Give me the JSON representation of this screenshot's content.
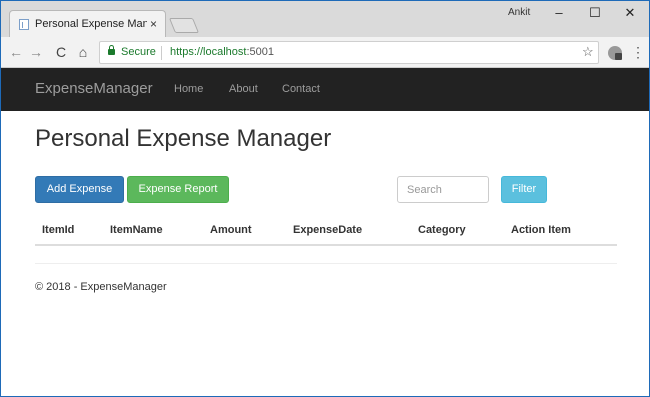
{
  "browser": {
    "tab_title": "Personal Expense Manag",
    "tab_close": "×",
    "user": "Ankit",
    "window_controls": {
      "minimize": "–",
      "maximize": "☐",
      "close": "✕"
    },
    "back": "←",
    "forward": "→",
    "reload": "C",
    "home": "⌂",
    "secure_label": "Secure",
    "url_scheme_host": "https://localhost",
    "url_port": ":5001",
    "star": "☆",
    "menu": "⋮"
  },
  "navbar": {
    "brand": "ExpenseManager",
    "links": [
      "Home",
      "About",
      "Contact"
    ]
  },
  "main": {
    "title": "Personal Expense Manager",
    "add_button": "Add Expense",
    "report_button": "Expense Report",
    "search_placeholder": "Search",
    "filter_button": "Filter",
    "table_headers": [
      "ItemId",
      "ItemName",
      "Amount",
      "ExpenseDate",
      "Category",
      "Action Item"
    ]
  },
  "footer": {
    "text": "© 2018 - ExpenseManager"
  },
  "colors": {
    "primary": "#337ab7",
    "success": "#5cb85c",
    "info": "#5bc0de",
    "navbar": "#222222",
    "secure_green": "#1b7a2c"
  }
}
